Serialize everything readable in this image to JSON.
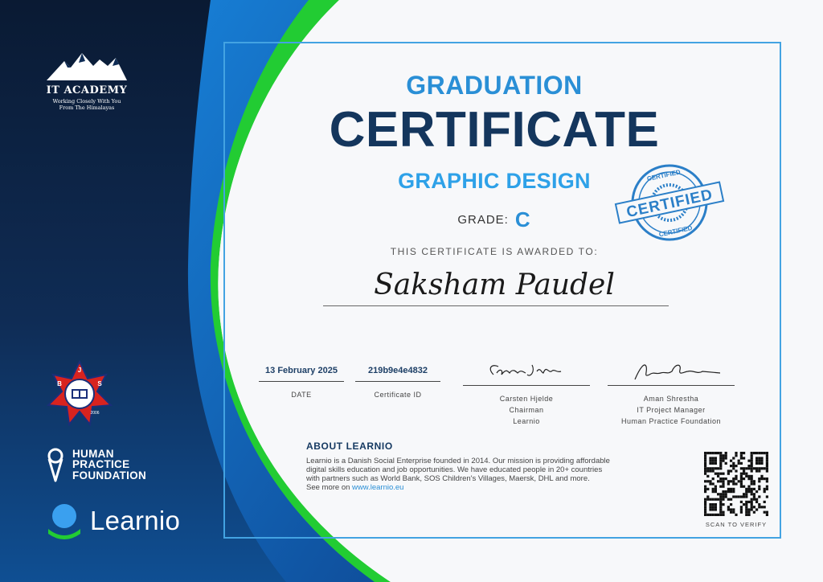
{
  "left_panel": {
    "it_academy": {
      "name": "IT ACADEMY",
      "tagline_1": "Working Closely With You",
      "tagline_2": "From The Himalayas"
    },
    "emblem_letters": [
      "B",
      "J",
      "S",
      "2006"
    ],
    "hpf": {
      "line_1": "HUMAN",
      "line_2": "PRACTICE",
      "line_3": "FOUNDATION"
    },
    "learnio": {
      "name": "Learnio"
    }
  },
  "certificate": {
    "heading_1": "GRADUATION",
    "heading_2": "CERTIFICATE",
    "course": "GRAPHIC DESIGN",
    "grade_label": "GRADE:",
    "grade_value": "C",
    "awarded_to_label": "THIS CERTIFICATE IS AWARDED TO:",
    "recipient": "Saksham Paudel"
  },
  "stamp": {
    "top_text": "CERTIFIED",
    "center_text": "CERTIFIED",
    "bottom_text": "CERTIFIED"
  },
  "details": {
    "date": {
      "value": "13 February 2025",
      "label": "DATE"
    },
    "certificate_id": {
      "value": "219b9e4e4832",
      "label": "Certificate ID"
    },
    "chairman": {
      "name": "Carsten Hjelde",
      "title": "Chairman",
      "org": "Learnio"
    },
    "project_manager": {
      "name": "Aman Shrestha",
      "title": "IT Project Manager",
      "org": "Human Practice Foundation"
    }
  },
  "about": {
    "heading": "ABOUT LEARNIO",
    "line_1": "Learnio is a Danish Social Enterprise founded in 2014. Our mission is providing affordable",
    "line_2": "digital skills education and job opportunities. We have educated people in 20+ countries",
    "line_3": "with partners such as World Bank, SOS Children's Villages, Maersk, DHL and more.",
    "see_more": "See more on ",
    "link": "www.learnio.eu"
  },
  "verify": {
    "label": "SCAN TO VERIFY"
  },
  "colors": {
    "navy": "#0d1f3a",
    "blue": "#1976c5",
    "light_blue": "#2ea1e8",
    "green": "#22cc33",
    "title_dark": "#14365d"
  }
}
